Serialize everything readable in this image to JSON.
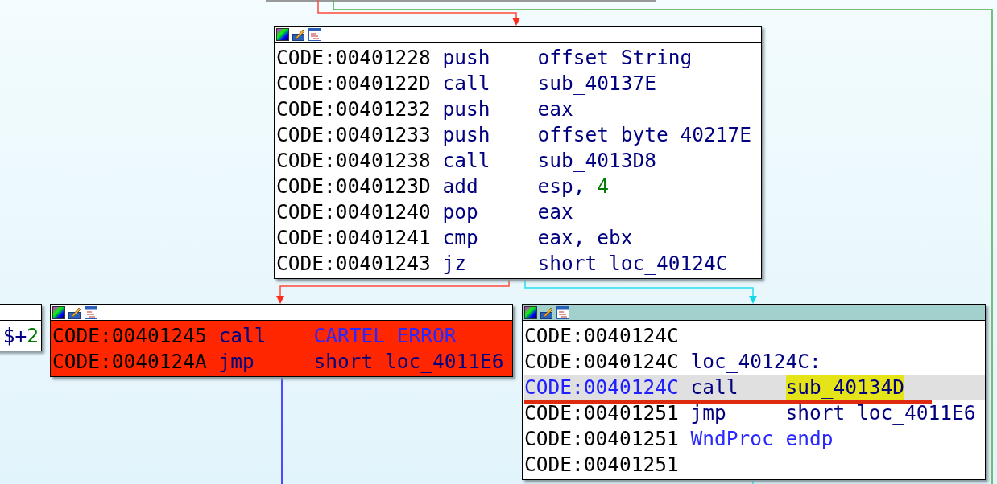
{
  "blocks": [
    {
      "color": "#ffffff",
      "selected": false,
      "lines": [
        {
          "address": "CODE:00401228",
          "mnemonic": {
            "text": "push",
            "kind": "code"
          },
          "operand": [
            {
              "text": "offset String",
              "kind": "code"
            }
          ],
          "selected": false
        },
        {
          "address": "CODE:0040122D",
          "mnemonic": {
            "text": "call",
            "kind": "code"
          },
          "operand": [
            {
              "text": "sub_40137E",
              "kind": "code"
            }
          ],
          "selected": false
        },
        {
          "address": "CODE:00401232",
          "mnemonic": {
            "text": "push",
            "kind": "code"
          },
          "operand": [
            {
              "text": "eax",
              "kind": "code"
            }
          ],
          "selected": false
        },
        {
          "address": "CODE:00401233",
          "mnemonic": {
            "text": "push",
            "kind": "code"
          },
          "operand": [
            {
              "text": "offset byte_40217E",
              "kind": "code"
            }
          ],
          "selected": false
        },
        {
          "address": "CODE:00401238",
          "mnemonic": {
            "text": "call",
            "kind": "code"
          },
          "operand": [
            {
              "text": "sub_4013D8",
              "kind": "code"
            }
          ],
          "selected": false
        },
        {
          "address": "CODE:0040123D",
          "mnemonic": {
            "text": "add",
            "kind": "code"
          },
          "operand": [
            {
              "text": "esp, ",
              "kind": "code"
            },
            {
              "text": "4",
              "kind": "number"
            }
          ],
          "selected": false
        },
        {
          "address": "CODE:00401240",
          "mnemonic": {
            "text": "pop",
            "kind": "code"
          },
          "operand": [
            {
              "text": "eax",
              "kind": "code"
            }
          ],
          "selected": false
        },
        {
          "address": "CODE:00401241",
          "mnemonic": {
            "text": "cmp",
            "kind": "code"
          },
          "operand": [
            {
              "text": "eax, ebx",
              "kind": "code"
            }
          ],
          "selected": false
        },
        {
          "address": "CODE:00401243",
          "mnemonic": {
            "text": "jz",
            "kind": "code"
          },
          "operand": [
            {
              "text": "short loc_40124C",
              "kind": "code"
            }
          ],
          "selected": false
        }
      ]
    },
    {
      "color": "#ffffff",
      "selected": false,
      "lines": [
        {
          "operand": [
            {
              "text": "$+",
              "kind": "code"
            },
            {
              "text": "2",
              "kind": "number"
            }
          ],
          "selected": false
        }
      ]
    },
    {
      "color": "#ff2600",
      "selected": false,
      "lines": [
        {
          "address": "CODE:00401245",
          "mnemonic": {
            "text": "call",
            "kind": "code"
          },
          "operand": [
            {
              "text": "CARTEL_ERROR",
              "kind": "name"
            }
          ],
          "selected": false
        },
        {
          "address": "CODE:0040124A",
          "mnemonic": {
            "text": "jmp",
            "kind": "code"
          },
          "operand": [
            {
              "text": "short loc_4011E6",
              "kind": "code"
            }
          ],
          "selected": false
        }
      ]
    },
    {
      "color": "#ffffff",
      "selected": true,
      "lines": [
        {
          "address": "CODE:0040124C",
          "selected": false
        },
        {
          "address": "CODE:0040124C",
          "mnemonic": {
            "text": "loc_40124C:",
            "kind": "code"
          },
          "selected": false
        },
        {
          "address": "CODE:0040124C",
          "mnemonic": {
            "text": "call",
            "kind": "code"
          },
          "operand": [
            {
              "text": "sub_40134D",
              "kind": "highlight"
            }
          ],
          "selected": true
        },
        {
          "address": "CODE:00401251",
          "mnemonic": {
            "text": "jmp",
            "kind": "code"
          },
          "operand": [
            {
              "text": "short loc_4011E6",
              "kind": "code"
            }
          ],
          "selected": false
        },
        {
          "address": "CODE:00401251",
          "mnemonic": {
            "text": "WndProc",
            "kind": "name"
          },
          "operand": [
            {
              "text": "endp",
              "kind": "name"
            }
          ],
          "selected": false
        },
        {
          "address": "CODE:00401251",
          "selected": false
        }
      ]
    }
  ]
}
